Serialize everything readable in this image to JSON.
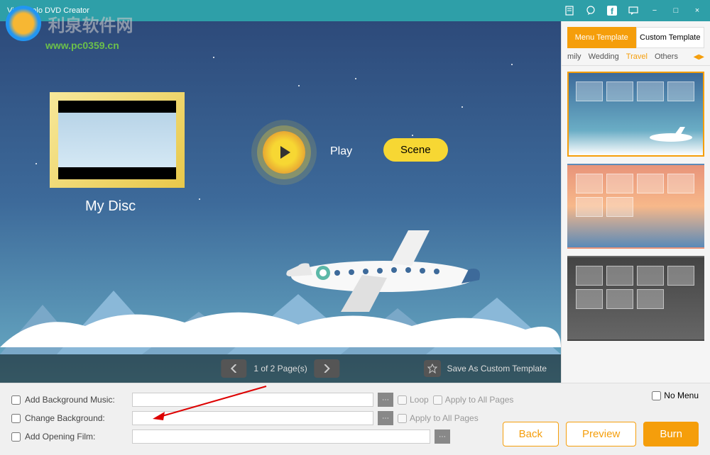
{
  "titlebar": {
    "title": "VideoSolo DVD Creator"
  },
  "watermark": {
    "text": "利泉软件网",
    "url": "www.pc0359.cn"
  },
  "preview": {
    "disc_title": "My Disc",
    "play_label": "Play",
    "scene_label": "Scene"
  },
  "pager": {
    "text": "1 of 2 Page(s)",
    "save_template": "Save As Custom Template"
  },
  "sidebar": {
    "tabs": [
      {
        "label": "Menu Template",
        "active": true
      },
      {
        "label": "Custom Template",
        "active": false
      }
    ],
    "subtabs": [
      {
        "label": "mily",
        "active": false
      },
      {
        "label": "Wedding",
        "active": false
      },
      {
        "label": "Travel",
        "active": true
      },
      {
        "label": "Others",
        "active": false
      }
    ]
  },
  "options": {
    "bg_music_label": "Add Background Music:",
    "change_bg_label": "Change Background:",
    "opening_film_label": "Add Opening Film:",
    "loop_label": "Loop",
    "apply_all_label": "Apply to All Pages",
    "no_menu_label": "No Menu"
  },
  "actions": {
    "back": "Back",
    "preview": "Preview",
    "burn": "Burn"
  },
  "colors": {
    "accent": "#f59e0b",
    "titlebar": "#2e9fa8"
  }
}
